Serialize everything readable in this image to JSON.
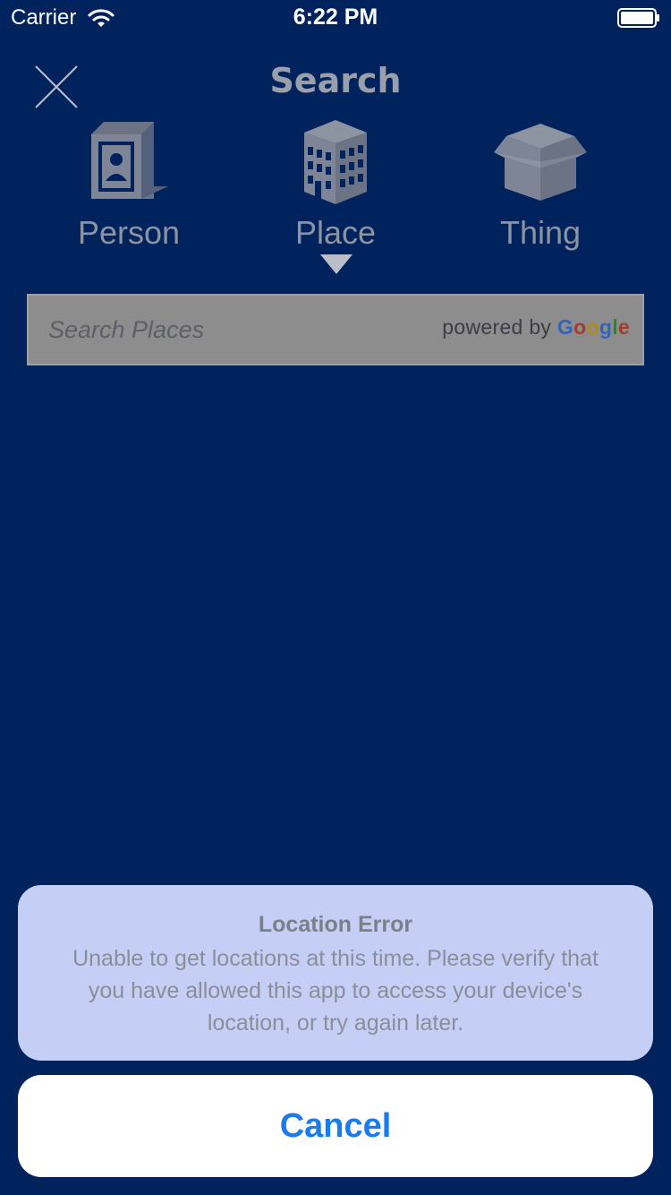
{
  "status_bar": {
    "carrier": "Carrier",
    "time": "6:22 PM",
    "wifi_icon": "wifi-icon",
    "battery_icon": "battery-icon"
  },
  "header": {
    "title": "Search",
    "close_icon": "close-icon"
  },
  "categories": [
    {
      "label": "Person",
      "icon": "person-card-box-icon",
      "selected": false
    },
    {
      "label": "Place",
      "icon": "building-icon",
      "selected": true
    },
    {
      "label": "Thing",
      "icon": "open-box-icon",
      "selected": false
    }
  ],
  "search": {
    "placeholder": "Search Places",
    "value": "",
    "powered_by": "powered by",
    "google": [
      "G",
      "o",
      "o",
      "g",
      "l",
      "e"
    ]
  },
  "alert": {
    "title": "Location Error",
    "message": "Unable to get locations at this time. Please verify that you have allowed this app to access your device's location, or try again later.",
    "cancel_label": "Cancel"
  },
  "colors": {
    "background": "#00235e",
    "icon_tint": "#8d94a1",
    "alert_background": "#c5cff6",
    "cancel_text": "#1a7bf0",
    "search_background": "#8d8d8e"
  }
}
